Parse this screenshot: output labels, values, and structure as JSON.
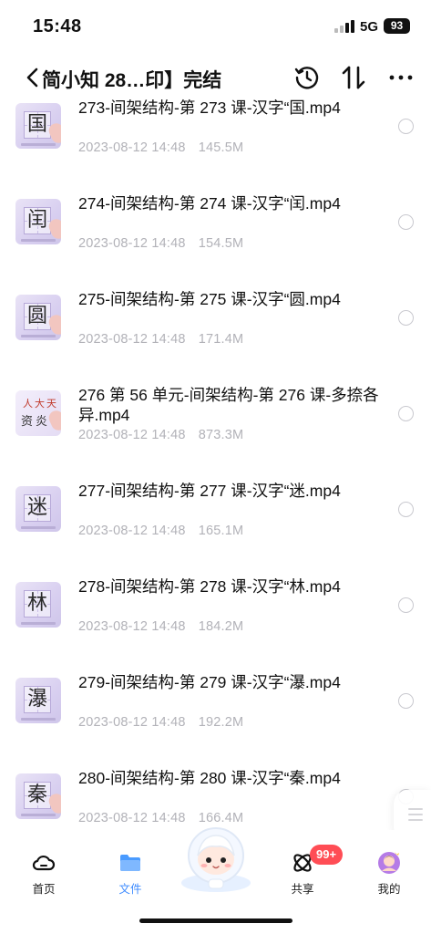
{
  "status": {
    "time": "15:48",
    "network": "5G",
    "battery": "93"
  },
  "nav": {
    "title": "简小知 28…印】完结",
    "icons": {
      "back": "chevron-left-icon",
      "history": "history-clock-icon",
      "sort": "sort-arrows-icon",
      "more": "more-dots-icon"
    }
  },
  "files": [
    {
      "name": "273-间架结构-第 273 课-汉字“国.mp4",
      "date": "2023-08-12 14:48",
      "size": "145.5M",
      "thumb_char": "国"
    },
    {
      "name": "274-间架结构-第 274 课-汉字“闰.mp4",
      "date": "2023-08-12 14:48",
      "size": "154.5M",
      "thumb_char": "闰"
    },
    {
      "name": "275-间架结构-第 275 课-汉字“圆.mp4",
      "date": "2023-08-12 14:48",
      "size": "171.4M",
      "thumb_char": "圆"
    },
    {
      "name": "276 第 56 单元-间架结构-第 276 课-多捺各异.mp4",
      "date": "2023-08-12 14:48",
      "size": "873.3M",
      "thumb_char": ""
    },
    {
      "name": "277-间架结构-第 277 课-汉字“迷.mp4",
      "date": "2023-08-12 14:48",
      "size": "165.1M",
      "thumb_char": "迷"
    },
    {
      "name": "278-间架结构-第 278 课-汉字“林.mp4",
      "date": "2023-08-12 14:48",
      "size": "184.2M",
      "thumb_char": "林"
    },
    {
      "name": "279-间架结构-第 279 课-汉字“瀑.mp4",
      "date": "2023-08-12 14:48",
      "size": "192.2M",
      "thumb_char": "瀑"
    },
    {
      "name": "280-间架结构-第 280 课-汉字“秦.mp4",
      "date": "2023-08-12 14:48",
      "size": "166.4M",
      "thumb_char": "秦"
    }
  ],
  "tabs": [
    {
      "label": "首页",
      "icon": "cloud-icon",
      "active": false
    },
    {
      "label": "文件",
      "icon": "folder-icon",
      "active": true
    },
    {
      "label": "共享",
      "icon": "share-orbit-icon",
      "active": false,
      "badge": "99+"
    },
    {
      "label": "我的",
      "icon": "avatar-icon",
      "active": false
    }
  ],
  "colors": {
    "accent": "#3d8bff",
    "badge": "#ff4d55",
    "meta_text": "#b2b2b8"
  }
}
